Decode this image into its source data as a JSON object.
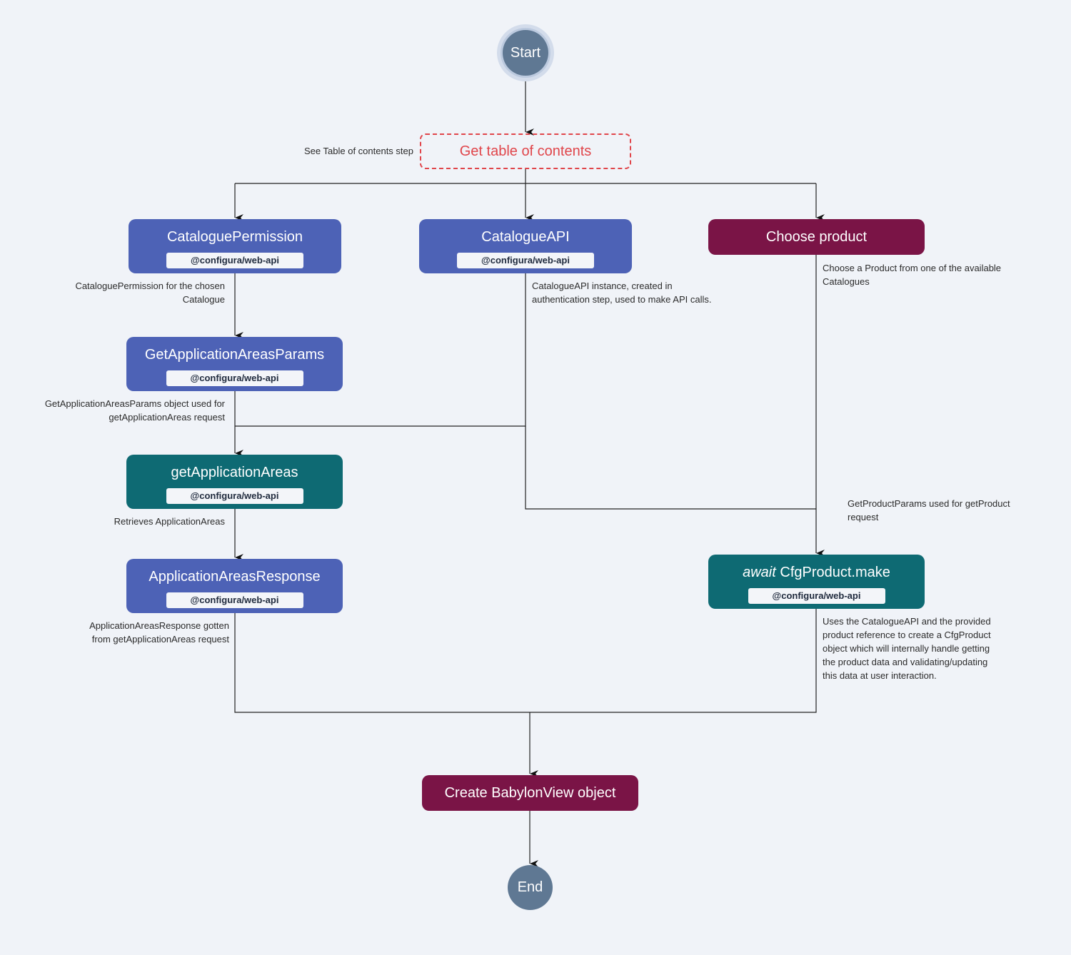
{
  "colors": {
    "background": "#f0f3f8",
    "blue_node": "#4d62b6",
    "teal_node": "#0e6a73",
    "maroon_node": "#7a1446",
    "terminal": "#5f7893",
    "reference_step": "#e0454a"
  },
  "start": "Start",
  "end": "End",
  "toc_step": {
    "title": "Get table of contents",
    "note": "See Table of contents step"
  },
  "nodes": {
    "catalogue_permission": {
      "title": "CataloguePermission",
      "badge": "@configura/web-api",
      "note": "CataloguePermission for the chosen\nCatalogue"
    },
    "catalogue_api": {
      "title": "CatalogueAPI",
      "badge": "@configura/web-api",
      "note": "CatalogueAPI instance, created in\nauthentication step, used to make API calls."
    },
    "choose_product": {
      "title": "Choose product",
      "note": "Choose a Product from one of the available\nCatalogues"
    },
    "get_app_areas_params": {
      "title": "GetApplicationAreasParams",
      "badge": "@configura/web-api",
      "note": "GetApplicationAreasParams object used for\ngetApplicationAreas request"
    },
    "get_app_areas": {
      "title": "getApplicationAreas",
      "badge": "@configura/web-api",
      "note": "Retrieves ApplicationAreas"
    },
    "app_areas_response": {
      "title": "ApplicationAreasResponse",
      "badge": "@configura/web-api",
      "note": "ApplicationAreasResponse gotten\nfrom getApplicationAreas request"
    },
    "cfg_product_make": {
      "title_italic": "await",
      "title": "CfgProduct.make",
      "badge": "@configura/web-api",
      "note": "Uses the CatalogueAPI and the provided\nproduct reference to create a CfgProduct\nobject which will internally handle getting\nthe product data and validating/updating\nthis data at user interaction.",
      "incoming_note": "GetProductParams used for getProduct\nrequest"
    },
    "create_babylon_view": {
      "title": "Create BabylonView object"
    }
  }
}
